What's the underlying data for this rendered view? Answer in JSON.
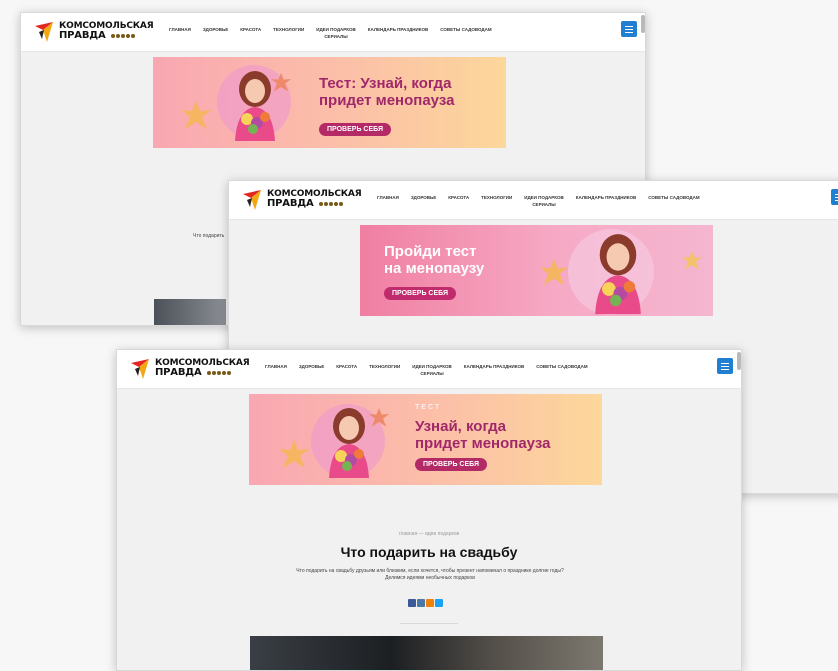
{
  "logo": {
    "top": "КОМСОМОЛЬСКАЯ",
    "bottom": "ПРАВДА"
  },
  "nav": [
    "ГЛАВНАЯ",
    "ЗДОРОВЬЕ",
    "КРАСОТА",
    "ТЕХНОЛОГИИ",
    "ИДЕИ ПОДАРКОВ\nСЕРИАЛЫ",
    "КАЛЕНДАРЬ ПРАЗДНИКОВ",
    "СОВЕТЫ САДОВОДАМ"
  ],
  "banner1": {
    "title": "Тест: Узнай, когда\nпридет менопауза",
    "cta": "ПРОВЕРЬ СЕБЯ"
  },
  "banner2": {
    "title": "Пройди тест\nна менопаузу",
    "cta": "ПРОВЕРЬ СЕБЯ"
  },
  "banner3": {
    "kicker": "ТЕСТ",
    "title": "Узнай, когда\nпридет менопауза",
    "cta": "ПРОВЕРЬ СЕБЯ"
  },
  "article": {
    "breadcrumb": "главная  —  идеи подарков",
    "title": "Что подарить на свадьбу",
    "lead": "Что подарить на свадьбу друзьям или близким, если хочется, чтобы презент напоминал о празднике долгие годы? Делимся идеями необычных подарков",
    "lead_fragment": "Что подарить"
  },
  "colors": {
    "menu_button": "#1f7fd1",
    "cta": "#b32a66",
    "share_facebook": "#3b5998",
    "share_vk": "#4a76a8",
    "share_ok": "#ee8208",
    "share_twitter": "#1da1f2"
  },
  "icons": [
    "logo-bird-icon",
    "hamburger-menu-icon",
    "facebook-icon",
    "vk-icon",
    "odnoklassniki-icon",
    "twitter-icon"
  ]
}
